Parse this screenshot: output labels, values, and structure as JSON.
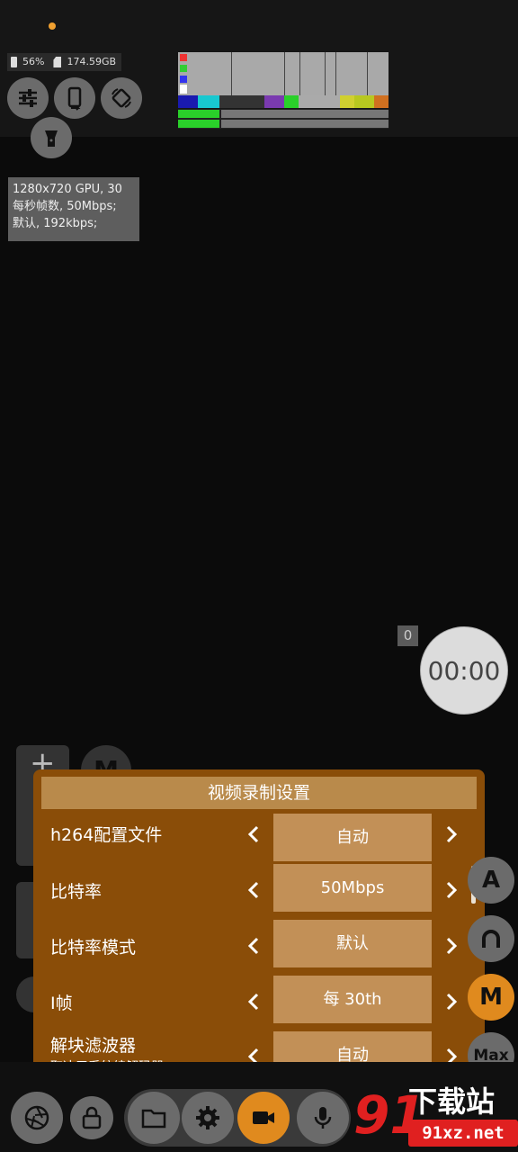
{
  "status": {
    "storage_battery": "56%",
    "storage_free": "174.59GB"
  },
  "info_box": {
    "line1": "1280x720 GPU, 30",
    "line2": "每秒帧数, 50Mbps;",
    "line3": "默认, 192kbps;"
  },
  "counter": "0",
  "timer": "00:00",
  "left_buttons": {
    "plus": "+",
    "m": "M"
  },
  "panel": {
    "title": "视频录制设置",
    "rows": [
      {
        "label": "h264配置文件",
        "sub": "",
        "value": "自动"
      },
      {
        "label": "比特率",
        "sub": "",
        "value": "50Mbps"
      },
      {
        "label": "比特率模式",
        "sub": "",
        "value": "默认"
      },
      {
        "label": "I帧",
        "sub": "",
        "value": "每 30th"
      },
      {
        "label": "解块滤波器",
        "sub": "取决于系统编解码器",
        "value": "自动"
      }
    ]
  },
  "right_buttons": {
    "a": "A",
    "m": "M",
    "max": "Max"
  },
  "icons": [
    "sliders-icon",
    "phone-icon",
    "rotate-icon",
    "flashlight-icon",
    "aperture-icon",
    "lock-icon",
    "folder-icon",
    "gear-icon",
    "video-camera-icon",
    "microphone-icon"
  ],
  "colors": {
    "panel": "#8a4d08",
    "panel_title": "#b98a4b",
    "value_box": "#c29057",
    "record_button": "#e08a1e",
    "watermark_red": "#e02020"
  },
  "watermark": {
    "mark": "91",
    "text": "下载站",
    "url": "91xz.net"
  }
}
